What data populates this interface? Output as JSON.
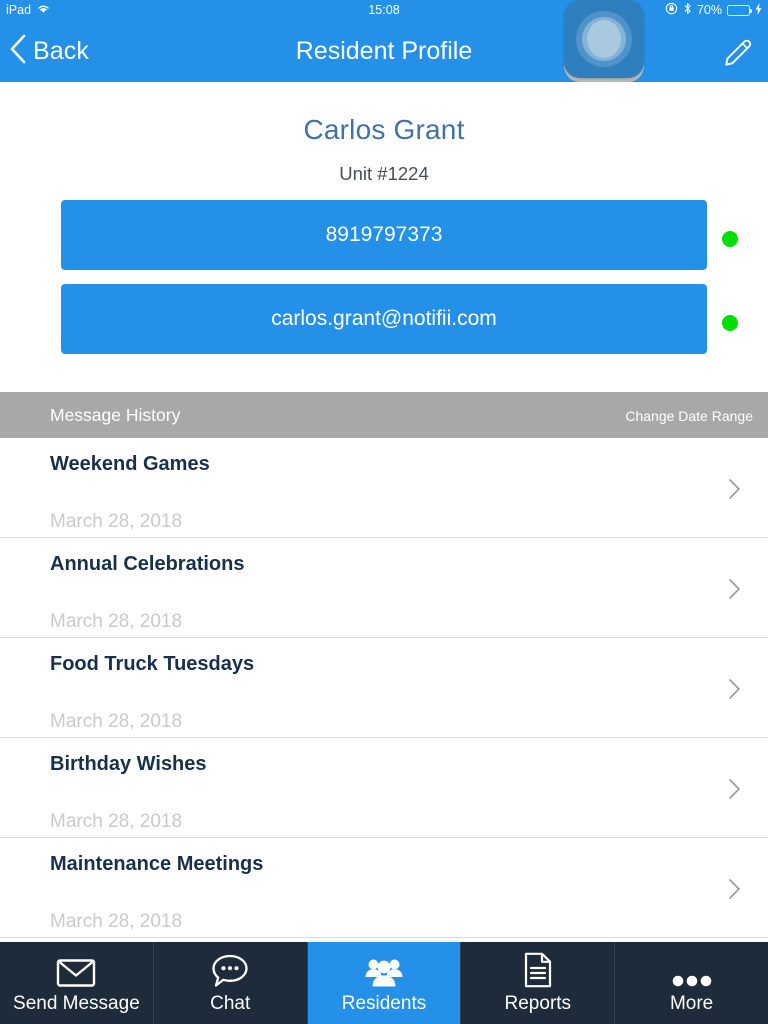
{
  "status_bar": {
    "device": "iPad",
    "wifi_icon": "wifi-icon",
    "time": "15:08",
    "rotation_lock_icon": "rotation-lock-icon",
    "bluetooth_icon": "bluetooth-icon",
    "battery_percent": "70%",
    "battery_level": 70,
    "charging_icon": "lightning-bolt-icon"
  },
  "nav": {
    "back_label": "Back",
    "back_icon": "chevron-left-icon",
    "title": "Resident Profile",
    "edit_icon": "pencil-icon"
  },
  "overlay": {
    "assistive_touch_icon": "assistive-touch-button"
  },
  "profile": {
    "name": "Carlos Grant",
    "unit": "Unit #1224",
    "contacts": [
      {
        "label": "8919797373",
        "type": "phone",
        "status": "active",
        "status_color": "#00e000"
      },
      {
        "label": "carlos.grant@notifii.com",
        "type": "email",
        "status": "active",
        "status_color": "#00e000"
      }
    ]
  },
  "message_history": {
    "title": "Message History",
    "change_date_range": "Change Date Range",
    "rows": [
      {
        "subject": "Weekend Games",
        "date": "March 28, 2018",
        "chevron": "chevron-right-icon"
      },
      {
        "subject": "Annual Celebrations",
        "date": "March 28, 2018",
        "chevron": "chevron-right-icon"
      },
      {
        "subject": "Food Truck Tuesdays",
        "date": "March 28, 2018",
        "chevron": "chevron-right-icon"
      },
      {
        "subject": "Birthday Wishes",
        "date": "March 28, 2018",
        "chevron": "chevron-right-icon"
      },
      {
        "subject": "Maintenance Meetings",
        "date": "March 28, 2018",
        "chevron": "chevron-right-icon"
      }
    ]
  },
  "tabbar": {
    "items": [
      {
        "label": "Send Message",
        "icon": "envelope-icon",
        "active": false
      },
      {
        "label": "Chat",
        "icon": "chat-bubble-icon",
        "active": false
      },
      {
        "label": "Residents",
        "icon": "people-group-icon",
        "active": true
      },
      {
        "label": "Reports",
        "icon": "document-icon",
        "active": false
      },
      {
        "label": "More",
        "icon": "ellipsis-icon",
        "active": false
      }
    ]
  },
  "colors": {
    "accent_blue": "#2490e8",
    "navy": "#1d2b3a",
    "header_gray": "#a8a8a8",
    "name_blue": "#4270ad",
    "subject_navy": "#18304a",
    "date_gray": "#c9cacc",
    "status_green": "#00e000"
  }
}
